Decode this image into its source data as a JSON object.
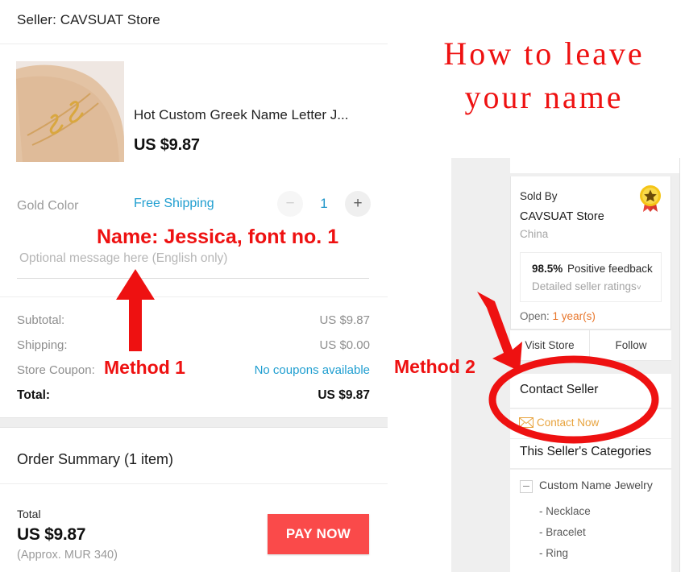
{
  "checkout": {
    "seller_header": "Seller: CAVSUAT Store",
    "product": {
      "title": "Hot Custom Greek Name Letter J...",
      "price": "US $9.87",
      "shipping_label": "Free Shipping",
      "quantity": "1",
      "minus_label": "−",
      "plus_label": "+",
      "variant": "Gold Color"
    },
    "message_field": {
      "placeholder": "Optional message here (English only)",
      "value": ""
    },
    "totals": [
      {
        "label": "Subtotal:",
        "value": "US $9.87",
        "link": false
      },
      {
        "label": "Shipping:",
        "value": "US $0.00",
        "link": false
      },
      {
        "label": "Store Coupon:",
        "value": "No coupons available",
        "link": true
      },
      {
        "label": "Total:",
        "value": "US $9.87",
        "link": false
      }
    ],
    "order_summary": {
      "title": "Order Summary (1 item)",
      "total_label": "Total",
      "total_value": "US $9.87",
      "approx": "(Approx. MUR 340)",
      "pay_button": "PAY NOW"
    }
  },
  "store_panel": {
    "sold_by_label": "Sold By",
    "store_name": "CAVSUAT Store",
    "country": "China",
    "badge_icon": "medal-icon",
    "feedback": {
      "percent": "98.5%",
      "text": "Positive feedback",
      "ratings_link": "Detailed seller ratings",
      "chevron": "˅"
    },
    "open_label": "Open:",
    "open_years": "1 year(s)",
    "visit_store": "Visit Store",
    "follow": "Follow",
    "contact_seller": "Contact Seller",
    "contact_now": "Contact Now",
    "categories_title": "This Seller's Categories",
    "category_parent": "Custom Name Jewelry",
    "category_children": [
      "- Necklace",
      "- Bracelet",
      "- Ring"
    ]
  },
  "annotations": {
    "title_line1": "How to leave",
    "title_line2": "your name",
    "name_note": "Name: Jessica, font no. 1",
    "method1": "Method 1",
    "method2": "Method 2"
  },
  "colors": {
    "annotation_red": "#ee1111",
    "pay_button": "#fa4a4a",
    "link_blue": "#1f9ed0",
    "orange": "#e8762b",
    "contact_gold": "#e8a33d"
  }
}
